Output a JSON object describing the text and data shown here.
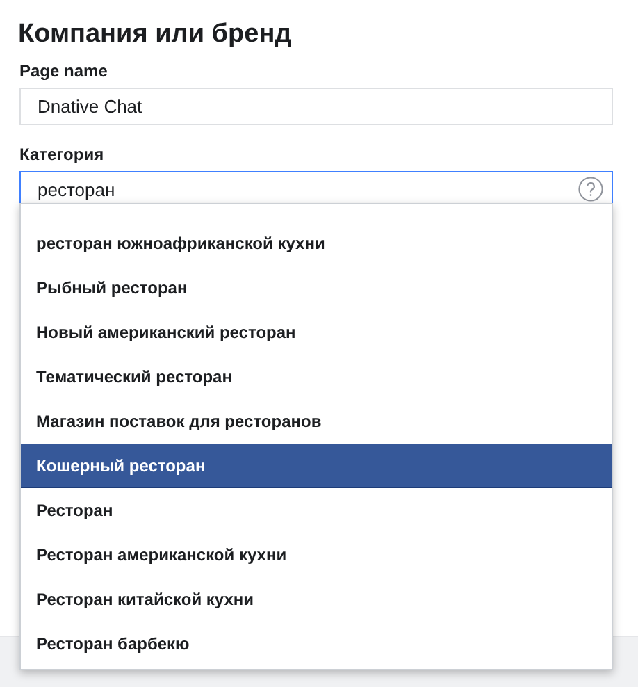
{
  "title": "Компания или бренд",
  "page_name": {
    "label": "Page name",
    "value": "Dnative Chat"
  },
  "category": {
    "label": "Категория",
    "value": "ресторан"
  },
  "suggestions": [
    {
      "label": "ресторан южноафриканской кухни",
      "selected": false
    },
    {
      "label": "Рыбный ресторан",
      "selected": false
    },
    {
      "label": "Новый американский ресторан",
      "selected": false
    },
    {
      "label": "Тематический ресторан",
      "selected": false
    },
    {
      "label": "Магазин поставок для ресторанов",
      "selected": false
    },
    {
      "label": "Кошерный ресторан",
      "selected": true
    },
    {
      "label": "Ресторан",
      "selected": false
    },
    {
      "label": "Ресторан американской кухни",
      "selected": false
    },
    {
      "label": "Ресторан китайской кухни",
      "selected": false
    },
    {
      "label": "Ресторан барбекю",
      "selected": false
    }
  ]
}
